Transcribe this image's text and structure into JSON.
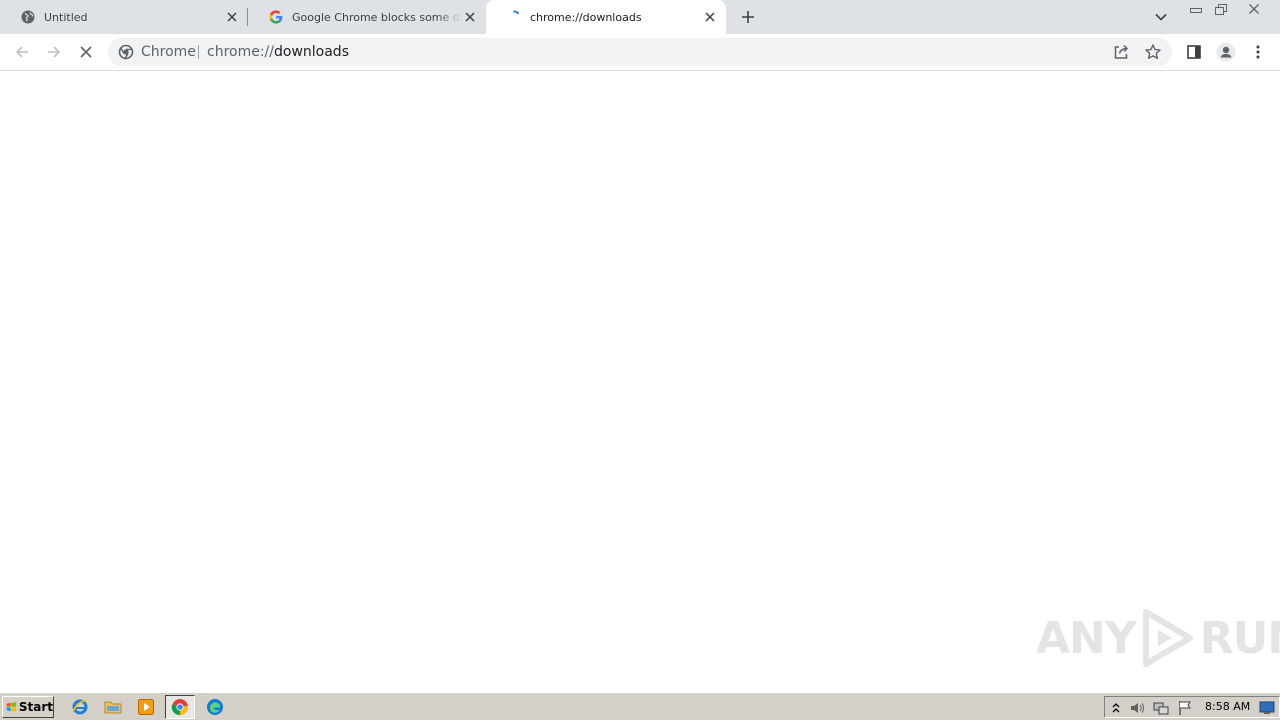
{
  "browser": {
    "tabs": [
      {
        "title": "Untitled",
        "icon": "globe-icon",
        "active": false
      },
      {
        "title": "Google Chrome blocks some downloads",
        "icon": "google-g-icon",
        "active": false
      },
      {
        "title": "chrome://downloads",
        "icon": "loading-spinner-icon",
        "active": true
      }
    ],
    "omnibox": {
      "chip_label": "Chrome",
      "url_scheme": "chrome://",
      "url_host": "downloads"
    },
    "colors": {
      "tab_strip": "#dee1e6",
      "omnibox_bg": "#f1f3f4",
      "google_blue": "#4285f4"
    }
  },
  "watermark": {
    "left_text": "ANY",
    "right_text": "RUN"
  },
  "taskbar": {
    "start_label": "Start",
    "pinned": [
      "ie-icon",
      "explorer-folder-icon",
      "media-player-icon",
      "chrome-icon",
      "edge-icon"
    ],
    "clock": "8:58 AM"
  }
}
